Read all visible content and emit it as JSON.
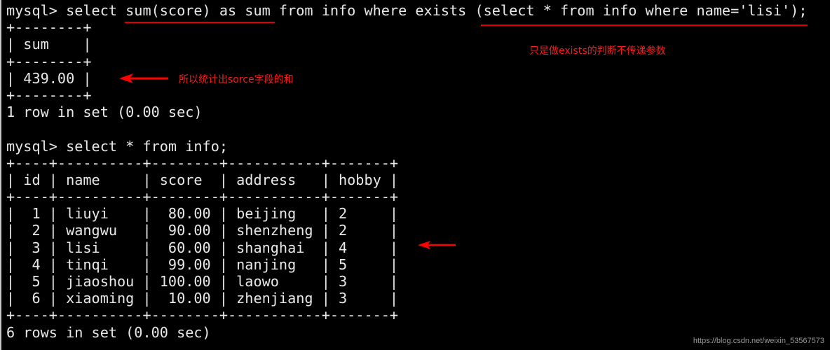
{
  "terminal": {
    "lines": [
      "mysql> select sum(score) as sum from info where exists (select * from info where name='lisi');",
      "+--------+",
      "| sum    |",
      "+--------+",
      "| 439.00 |",
      "+--------+",
      "1 row in set (0.00 sec)",
      "",
      "mysql> select * from info;",
      "+----+----------+--------+-----------+-------+",
      "| id | name     | score  | address   | hobby |",
      "+----+----------+--------+-----------+-------+",
      "|  1 | liuyi    |  80.00 | beijing   | 2     |",
      "|  2 | wangwu   |  90.00 | shenzheng | 2     |",
      "|  3 | lisi     |  60.00 | shanghai  | 4     |",
      "|  4 | tinqi    |  99.00 | nanjing   | 5     |",
      "|  5 | jiaoshou | 100.00 | laowo     | 3     |",
      "|  6 | xiaoming |  10.00 | zhenjiang | 3     |",
      "+----+----------+--------+-----------+-------+",
      "6 rows in set (0.00 sec)"
    ],
    "query1": "select sum(score) as sum from info where exists (select * from info where name='lisi');",
    "query2": "select * from info;",
    "result1": {
      "columns": [
        "sum"
      ],
      "rows": [
        [
          "439.00"
        ]
      ],
      "footer": "1 row in set (0.00 sec)"
    },
    "result2": {
      "columns": [
        "id",
        "name",
        "score",
        "address",
        "hobby"
      ],
      "rows": [
        [
          "1",
          "liuyi",
          "80.00",
          "beijing",
          "2"
        ],
        [
          "2",
          "wangwu",
          "90.00",
          "shenzheng",
          "2"
        ],
        [
          "3",
          "lisi",
          "60.00",
          "shanghai",
          "4"
        ],
        [
          "4",
          "tinqi",
          "99.00",
          "nanjing",
          "5"
        ],
        [
          "5",
          "jiaoshou",
          "100.00",
          "laowo",
          "3"
        ],
        [
          "6",
          "xiaoming",
          "10.00",
          "zhenjiang",
          "3"
        ]
      ],
      "footer": "6 rows in set (0.00 sec)"
    }
  },
  "annotations": {
    "exists_note": "只是做exists的判断不传递参数",
    "sum_note": "所以统计出sorce字段的和"
  },
  "colors": {
    "background": "#000000",
    "text": "#e8e8e8",
    "annotation": "#ff1a1a"
  },
  "watermark": "https://blog.csdn.net/weixin_53567573"
}
